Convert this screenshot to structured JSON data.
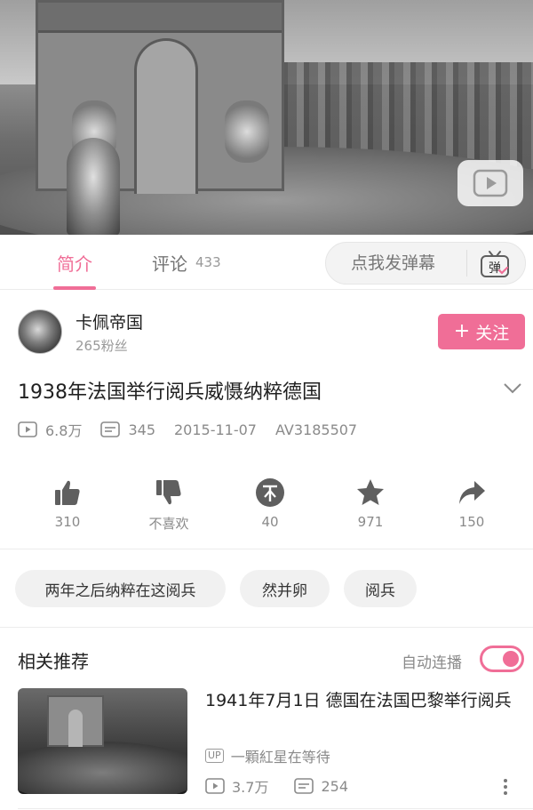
{
  "tabs": {
    "intro": "简介",
    "comments": "评论",
    "comment_count": "433"
  },
  "danmaku": {
    "placeholder": "点我发弹幕",
    "icon_text": "弹"
  },
  "uploader": {
    "name": "卡佩帝国",
    "fans": "265粉丝",
    "follow_label": "关注"
  },
  "video": {
    "title": "1938年法国举行阅兵威慑纳粹德国",
    "views": "6.8万",
    "danmaku_count": "345",
    "date": "2015-11-07",
    "av": "AV3185507"
  },
  "actions": {
    "like": "310",
    "dislike": "不喜欢",
    "coin": "40",
    "favorite": "971",
    "share": "150"
  },
  "tags": [
    "两年之后纳粹在这阅兵",
    "然并卵",
    "阅兵"
  ],
  "related": {
    "heading": "相关推荐",
    "autoplay_label": "自动连播",
    "autoplay_on": true,
    "items": [
      {
        "title": "1941年7月1日   德国在法国巴黎举行阅兵",
        "up_badge": "UP",
        "uploader": "一顆紅星在等待",
        "views": "3.7万",
        "danmaku": "254"
      }
    ]
  },
  "colors": {
    "accent": "#f06e97",
    "text": "#212121",
    "muted": "#8a8a8a",
    "tag_bg": "#f1f1f1",
    "icon": "#5f5f5f"
  },
  "icons": {
    "play": "play-icon",
    "danmaku": "tv-icon",
    "views": "play-square-icon",
    "danmaku_count": "danmaku-icon",
    "like": "thumb-up-icon",
    "dislike": "thumb-down-icon",
    "coin": "coin-icon",
    "favorite": "star-icon",
    "share": "share-icon",
    "expand": "chevron-down-icon",
    "more": "more-vertical-icon"
  }
}
